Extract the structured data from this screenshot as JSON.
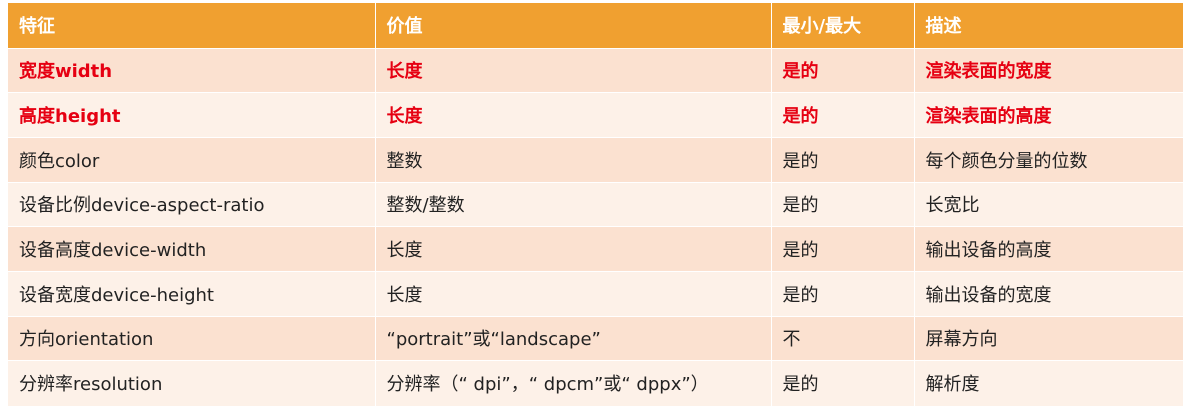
{
  "table": {
    "headers": [
      "特征",
      "价值",
      "最小/最大",
      "描述"
    ],
    "rows": [
      {
        "cells": [
          "宽度width",
          "长度",
          "是的",
          "渲染表面的宽度"
        ],
        "highlight": true
      },
      {
        "cells": [
          "高度height",
          "长度",
          "是的",
          "渲染表面的高度"
        ],
        "highlight": true
      },
      {
        "cells": [
          "颜色color",
          "整数",
          "是的",
          "每个颜色分量的位数"
        ],
        "highlight": false
      },
      {
        "cells": [
          "设备比例device-aspect-ratio",
          "整数/整数",
          "是的",
          "长宽比"
        ],
        "highlight": false
      },
      {
        "cells": [
          "设备高度device-width",
          "长度",
          "是的",
          "输出设备的高度"
        ],
        "highlight": false
      },
      {
        "cells": [
          "设备宽度device-height",
          "长度",
          "是的",
          "输出设备的宽度"
        ],
        "highlight": false
      },
      {
        "cells": [
          "方向orientation",
          "“portrait”或“landscape”",
          "不",
          "屏幕方向"
        ],
        "highlight": false
      },
      {
        "cells": [
          "分辨率resolution",
          "分辨率（“ dpi”，“ dpcm”或“ dppx”）",
          "是的",
          "解析度"
        ],
        "highlight": false
      }
    ],
    "colors": {
      "header_bg": "#F0A030",
      "row_odd_bg": "#FBE1D0",
      "row_even_bg": "#FDF1E8",
      "highlight_text": "#E60012"
    }
  }
}
